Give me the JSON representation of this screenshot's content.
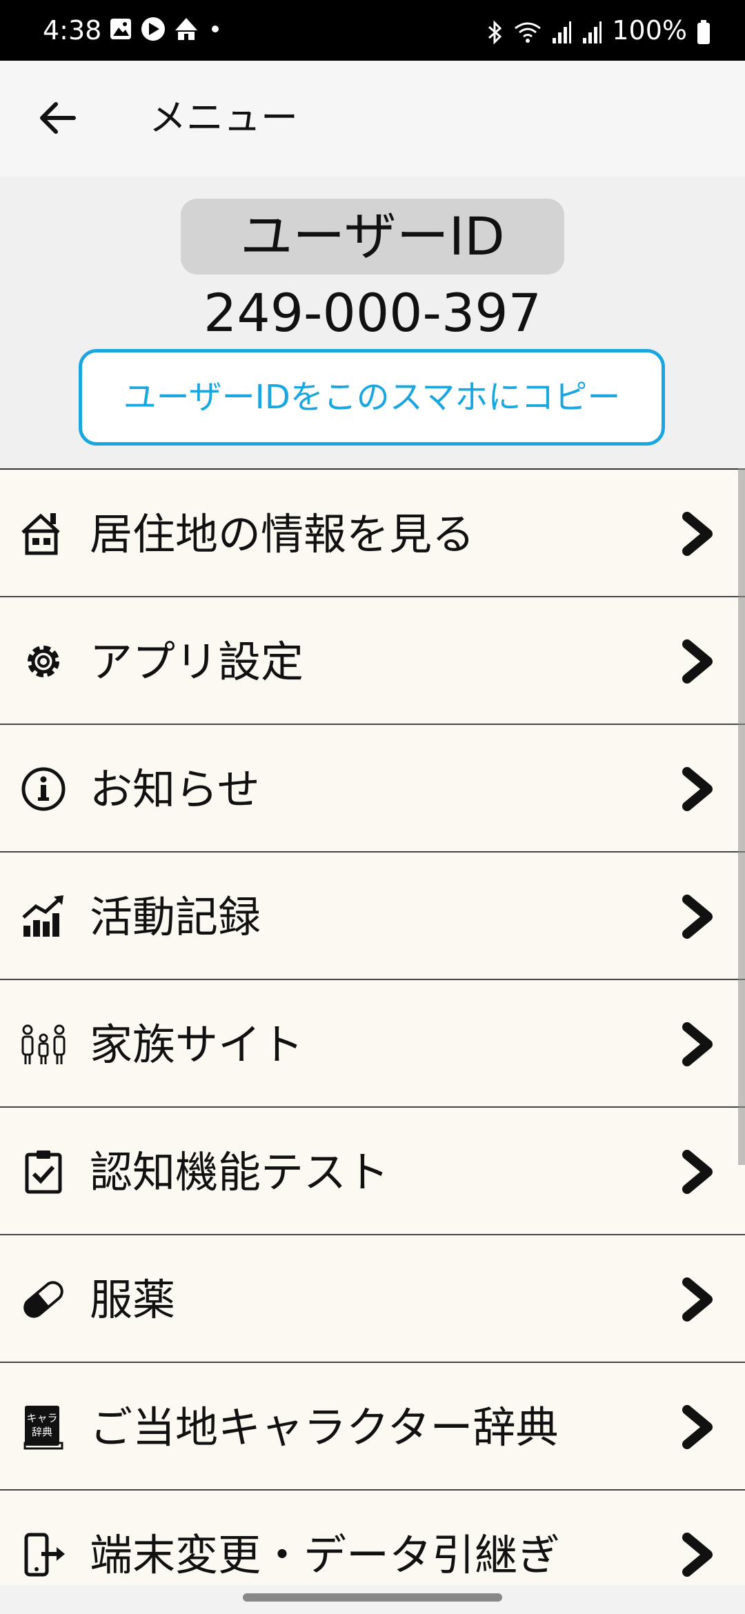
{
  "status_bar": {
    "time": "4:38",
    "battery": "100%"
  },
  "app_bar": {
    "title": "メニュー"
  },
  "user": {
    "id_label": "ユーザーID",
    "id_value": "249-000-397",
    "copy_button": "ユーザーIDをこのスマホにコピー"
  },
  "menu": {
    "items": [
      {
        "label": "居住地の情報を見る",
        "icon": "house-icon"
      },
      {
        "label": "アプリ設定",
        "icon": "gear-icon"
      },
      {
        "label": "お知らせ",
        "icon": "info-icon"
      },
      {
        "label": "活動記録",
        "icon": "bar-chart-icon"
      },
      {
        "label": "家族サイト",
        "icon": "family-icon"
      },
      {
        "label": "認知機能テスト",
        "icon": "clipboard-check-icon"
      },
      {
        "label": "服薬",
        "icon": "pill-icon"
      },
      {
        "label": "ご当地キャラクター辞典",
        "icon": "dictionary-book-icon",
        "icon_text_top": "キャラ",
        "icon_text_bottom": "辞典"
      },
      {
        "label": "端末変更・データ引継ぎ",
        "icon": "phone-transfer-icon"
      }
    ]
  },
  "colors": {
    "accent": "#1aa7e0",
    "menu_bg": "#fbf9f2"
  }
}
